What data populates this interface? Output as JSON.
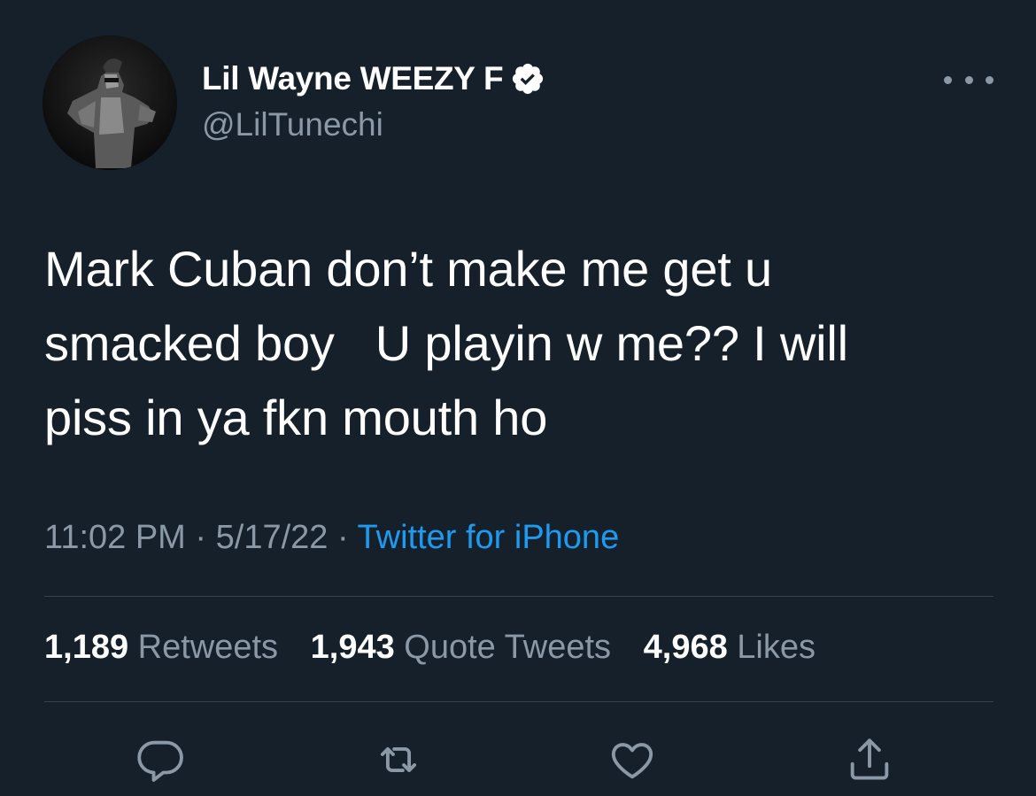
{
  "tweet": {
    "author": {
      "display_name": "Lil Wayne WEEZY F",
      "handle": "@LilTunechi",
      "verified": true
    },
    "text": "Mark Cuban don’t make me get u\nsmacked boy   U playin w me?? I will\npiss in ya fkn mouth ho",
    "time": "11:02 PM",
    "separator": "·",
    "date": "5/17/22",
    "source": "Twitter for iPhone",
    "stats": [
      {
        "count": "1,189",
        "label": "Retweets"
      },
      {
        "count": "1,943",
        "label": "Quote Tweets"
      },
      {
        "count": "4,968",
        "label": "Likes"
      }
    ]
  },
  "icons": {
    "more": "more-icon",
    "reply": "reply-icon",
    "retweet": "retweet-icon",
    "like": "like-icon",
    "share": "share-icon",
    "verified": "verified-badge-icon"
  },
  "colors": {
    "background": "#15202b",
    "text": "#ffffff",
    "secondary": "#8b98a5",
    "accent": "#1d9bf0",
    "divider": "#38444d"
  }
}
